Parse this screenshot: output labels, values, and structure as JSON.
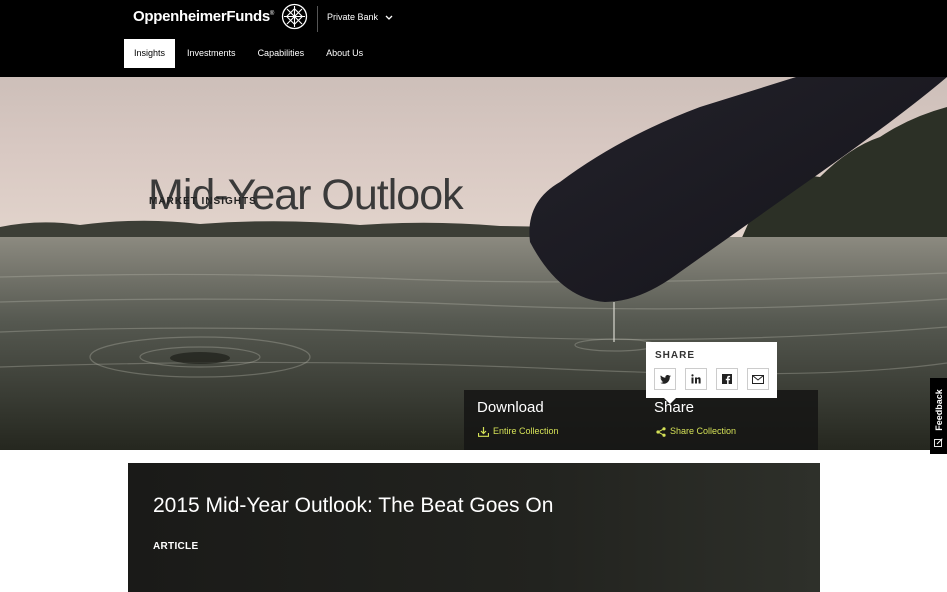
{
  "header": {
    "logo_text": "OppenheimerFunds",
    "logo_mark": "®",
    "private_bank_label": "Private Bank",
    "nav": [
      {
        "label": "Insights",
        "active": true
      },
      {
        "label": "Investments",
        "active": false
      },
      {
        "label": "Capabilities",
        "active": false
      },
      {
        "label": "About Us",
        "active": false
      }
    ]
  },
  "hero": {
    "title": "Mid-Year Outlook",
    "subtitle": "MARKET INSIGHTS"
  },
  "download_bar": {
    "download_title": "Download",
    "download_link": "Entire Collection",
    "share_title": "Share",
    "share_link": "Share Collection"
  },
  "share_popover": {
    "label": "SHARE",
    "buttons": [
      "twitter-icon",
      "linkedin-icon",
      "facebook-icon",
      "email-icon"
    ]
  },
  "feedback_tab": {
    "label": "Feedback"
  },
  "article_card": {
    "title": "2015 Mid-Year Outlook: The Beat Goes On",
    "type": "ARTICLE"
  },
  "colors": {
    "accent_link": "#d4e157",
    "header_bg": "#000000"
  }
}
